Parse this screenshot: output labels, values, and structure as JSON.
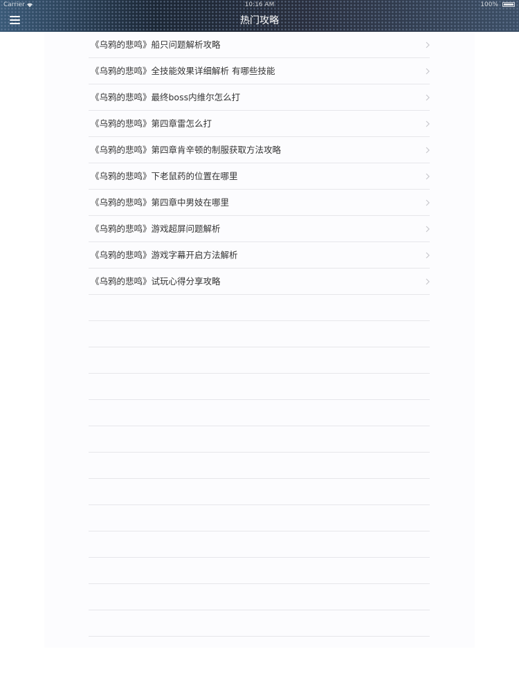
{
  "status_bar": {
    "carrier": "Carrier",
    "time": "10:16 AM",
    "battery": "100%"
  },
  "nav": {
    "title": "热门攻略",
    "menu_icon": "hamburger-menu-icon"
  },
  "list": {
    "items": [
      {
        "label": "《乌鸦的悲鸣》船只问题解析攻略"
      },
      {
        "label": "《乌鸦的悲鸣》全技能效果详细解析 有哪些技能"
      },
      {
        "label": "《乌鸦的悲鸣》最终boss内维尔怎么打"
      },
      {
        "label": "《乌鸦的悲鸣》第四章雷怎么打"
      },
      {
        "label": "《乌鸦的悲鸣》第四章肯辛顿的制服获取方法攻略"
      },
      {
        "label": "《乌鸦的悲鸣》下老鼠药的位置在哪里"
      },
      {
        "label": "《乌鸦的悲鸣》第四章中男妓在哪里"
      },
      {
        "label": "《乌鸦的悲鸣》游戏超屏问题解析"
      },
      {
        "label": "《乌鸦的悲鸣》游戏字幕开启方法解析"
      },
      {
        "label": "《乌鸦的悲鸣》试玩心得分享攻略"
      }
    ],
    "chevron_icon": "chevron-right-icon"
  },
  "colors": {
    "header_bg": "#1d2a3a",
    "text": "#333333",
    "separator": "#e6e6ea",
    "chevron": "#c7c7cc"
  }
}
